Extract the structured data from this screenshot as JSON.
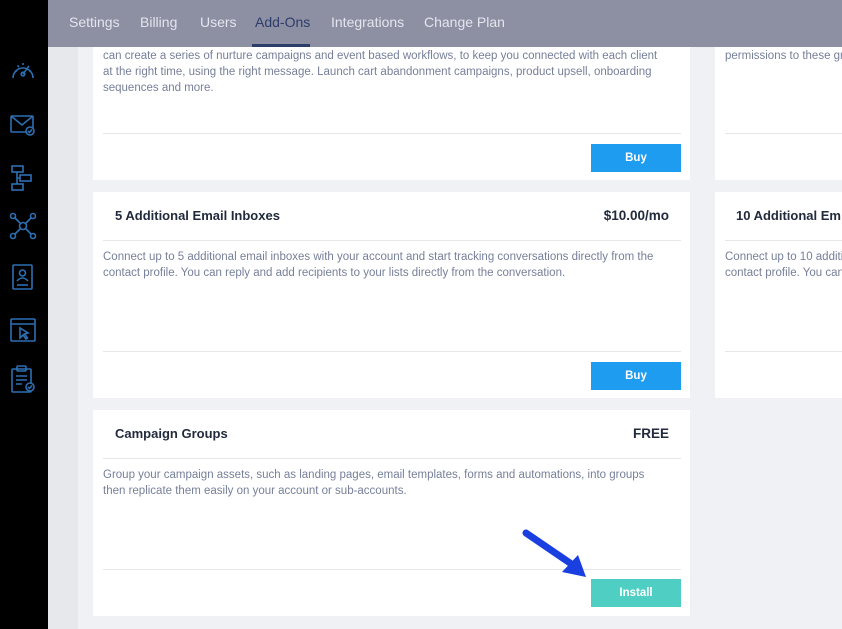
{
  "nav": {
    "tabs": [
      {
        "label": "Settings"
      },
      {
        "label": "Billing"
      },
      {
        "label": "Users"
      },
      {
        "label": "Add-Ons"
      },
      {
        "label": "Integrations"
      },
      {
        "label": "Change Plan"
      }
    ],
    "active_tab": "Add-Ons"
  },
  "sidebar": {
    "icons": [
      "dashboard-gauge-icon",
      "email-icon",
      "workflow-icon",
      "network-icon",
      "contact-card-icon",
      "browser-cursor-icon",
      "clipboard-checklist-icon"
    ]
  },
  "cards": {
    "workflows": {
      "description": "can create a series of nurture campaigns and event based workflows, to keep you connected with each client at the right time, using the right message. Launch cart abandonment campaigns, product upsell, onboarding sequences and more.",
      "button": "Buy"
    },
    "permissions_partial": {
      "description": "permissions to these gr"
    },
    "inboxes5": {
      "title": "5 Additional Email Inboxes",
      "price": "$10.00/mo",
      "description": "Connect up to 5 additional email inboxes with your account and start tracking conversations directly from the contact profile. You can reply and add recipients to your lists directly from the conversation.",
      "button": "Buy"
    },
    "inboxes10": {
      "title": "10 Additional Em",
      "description": "Connect up to 10 additi contact profile. You can"
    },
    "campaign_groups": {
      "title": "Campaign Groups",
      "price": "FREE",
      "description": "Group your campaign assets, such as landing pages, email templates, forms and automations, into groups then replicate them easily on your account or sub-accounts.",
      "button": "Install"
    }
  },
  "colors": {
    "sidebar": "#000000",
    "topnav": "#8d8fa3",
    "active_tab": "#2d3d6a",
    "buy_button": "#1e9cf0",
    "install_button": "#4fcfc3",
    "arrow": "#1a3fe0"
  }
}
